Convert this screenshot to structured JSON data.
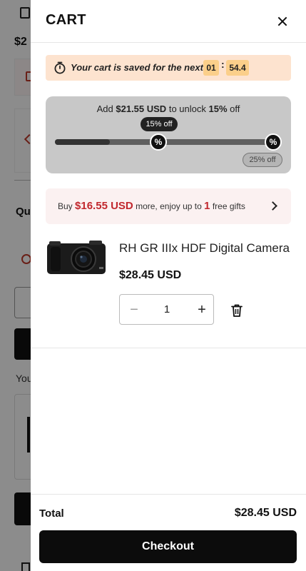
{
  "cart": {
    "title": "CART"
  },
  "timer": {
    "message": "Your cart is saved for the next",
    "minutes": "01",
    "separator": ":",
    "seconds": "54.4"
  },
  "discount": {
    "prefix": "Add",
    "amount": "$21.55 USD",
    "middle": "to unlock",
    "percent": "15%",
    "suffix": "off",
    "progress_fraction": 0.25,
    "tiers": [
      {
        "label": "15% off",
        "icon": "discount-tag-icon"
      },
      {
        "label": "25% off",
        "icon": "discount-tag-icon"
      }
    ]
  },
  "gift": {
    "prefix": "Buy",
    "amount": "$16.55 USD",
    "middle": "more, enjoy up to",
    "count": "1",
    "suffix": "free gifts",
    "icon": "chevron-right-icon"
  },
  "item": {
    "name": "RH GR IIIx HDF Digital Camera",
    "price": "$28.45 USD",
    "quantity": "1",
    "minus": "−",
    "plus": "+",
    "delete_icon": "trash-icon"
  },
  "footer": {
    "total_label": "Total",
    "total_value": "$28.45 USD",
    "checkout_label": "Checkout"
  },
  "background": {
    "price_fragment": "$2",
    "heading_fragment": "Qu",
    "section_fragment": "You"
  },
  "colors": {
    "accent_red": "#c1272d",
    "timer_bg": "#fde3cf",
    "timer_box": "#fbcf8a",
    "panel_bg": "#c8c8c8",
    "button_bg": "#0c0c0c"
  }
}
